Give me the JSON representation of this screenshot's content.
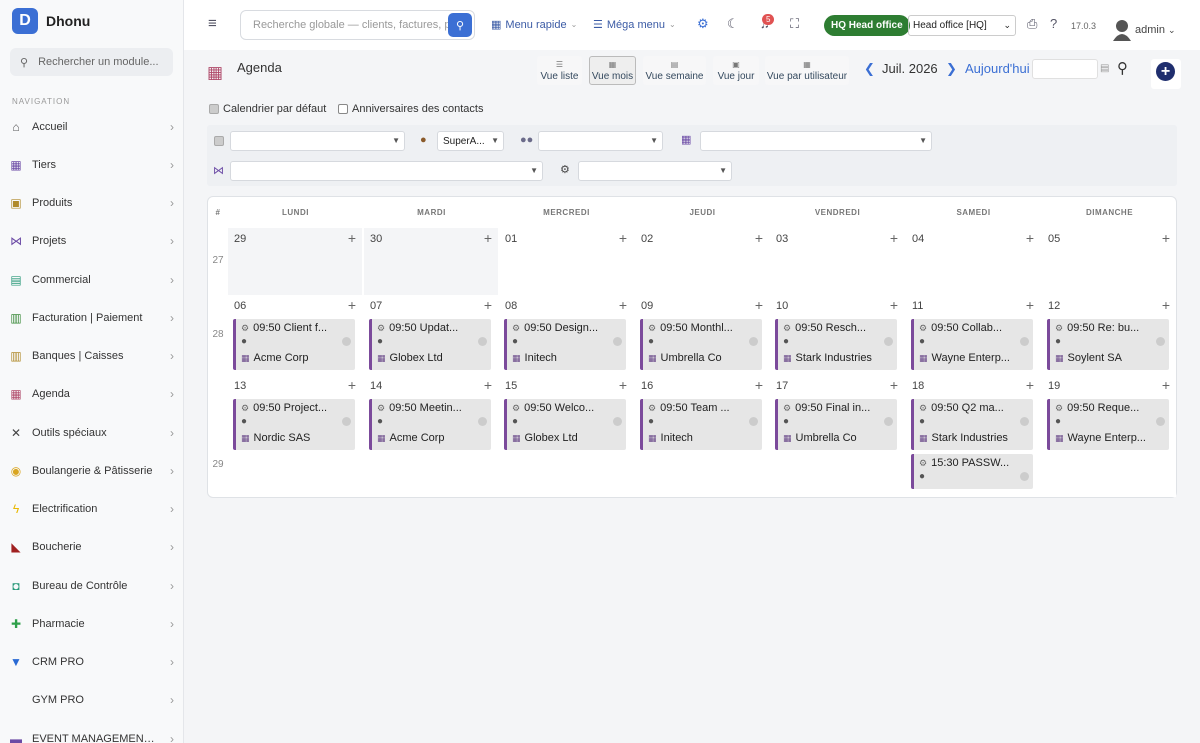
{
  "app": {
    "name": "Dhonu",
    "logo_letter": "D"
  },
  "sidebar": {
    "search_placeholder": "Rechercher un module...",
    "nav_heading": "NAVIGATION",
    "items": [
      {
        "label": "Accueil",
        "icon": "home-icon",
        "glyph": "⌂",
        "color": "#555"
      },
      {
        "label": "Tiers",
        "icon": "building-icon",
        "glyph": "▦",
        "color": "#6b4aa5"
      },
      {
        "label": "Produits",
        "icon": "box-icon",
        "glyph": "▣",
        "color": "#b08a2a"
      },
      {
        "label": "Projets",
        "icon": "sitemap-icon",
        "glyph": "⋈",
        "color": "#6b4aa5"
      },
      {
        "label": "Commercial",
        "icon": "briefcase-icon",
        "glyph": "▤",
        "color": "#2a9a7a"
      },
      {
        "label": "Facturation | Paiement",
        "icon": "invoice-icon",
        "glyph": "▥",
        "color": "#3a8a3a"
      },
      {
        "label": "Banques | Caisses",
        "icon": "bank-icon",
        "glyph": "▥",
        "color": "#b08a2a"
      },
      {
        "label": "Agenda",
        "icon": "calendar-icon",
        "glyph": "▦",
        "color": "#b04a6a"
      },
      {
        "label": "Outils spéciaux",
        "icon": "tools-icon",
        "glyph": "✕",
        "color": "#444"
      },
      {
        "label": "Boulangerie & Pâtisserie",
        "icon": "bread-icon",
        "glyph": "◉",
        "color": "#d9a520"
      },
      {
        "label": "Electrification",
        "icon": "bolt-icon",
        "glyph": "ϟ",
        "color": "#e8b800"
      },
      {
        "label": "Boucherie",
        "icon": "meat-icon",
        "glyph": "◣",
        "color": "#a02020"
      },
      {
        "label": "Bureau de Contrôle",
        "icon": "control-icon",
        "glyph": "◘",
        "color": "#2a9a7a"
      },
      {
        "label": "Pharmacie",
        "icon": "cross-icon",
        "glyph": "✚",
        "color": "#2ea04a"
      },
      {
        "label": "CRM PRO",
        "icon": "filter-icon",
        "glyph": "▼",
        "color": "#2a6ad4"
      },
      {
        "label": "GYM PRO",
        "icon": "gym-icon",
        "glyph": "",
        "color": "#444"
      },
      {
        "label": "EVENT MANAGEMENT P...",
        "icon": "event-icon",
        "glyph": "▬",
        "color": "#6b4aa5"
      }
    ]
  },
  "topbar": {
    "search_placeholder": "Recherche globale — clients, factures, p",
    "menu_rapide": "Menu rapide",
    "mega_menu": "Méga menu",
    "notif_count": "5",
    "hq_badge": "HQ Head office",
    "entity_select": "Head office [HQ]",
    "version": "17.0.3",
    "user": "admin"
  },
  "agenda": {
    "title": "Agenda",
    "views": [
      "Vue liste",
      "Vue mois",
      "Vue semaine",
      "Vue jour",
      "Vue par utilisateur"
    ],
    "active_view": "Vue mois",
    "month": "Juil. 2026",
    "today": "Aujourd'hui",
    "checkbox_default": "Calendrier par défaut",
    "checkbox_birthdays": "Anniversaires des contacts",
    "filter_user": "SuperA...",
    "week_col": "#",
    "day_headers": [
      "LUNDI",
      "MARDI",
      "MERCREDI",
      "JEUDI",
      "VENDREDI",
      "SAMEDI",
      "DIMANCHE"
    ]
  },
  "weeks": [
    {
      "num": "27",
      "days": [
        "29",
        "30",
        "01",
        "02",
        "03",
        "04",
        "05"
      ]
    },
    {
      "num": "28",
      "days": [
        "06",
        "07",
        "08",
        "09",
        "10",
        "11",
        "12"
      ]
    },
    {
      "num": "29",
      "days": [
        "13",
        "14",
        "15",
        "16",
        "17",
        "18",
        "19"
      ]
    }
  ],
  "events": {
    "week28": [
      {
        "title": "09:50 Client f...",
        "company": "Acme Corp"
      },
      {
        "title": "09:50 Updat...",
        "company": "Globex Ltd"
      },
      {
        "title": "09:50 Design...",
        "company": "Initech"
      },
      {
        "title": "09:50 Monthl...",
        "company": "Umbrella Co"
      },
      {
        "title": "09:50 Resch...",
        "company": "Stark Industries"
      },
      {
        "title": "09:50 Collab...",
        "company": "Wayne Enterp..."
      },
      {
        "title": "09:50 Re: bu...",
        "company": "Soylent SA"
      }
    ],
    "week29": [
      {
        "title": "09:50 Project...",
        "company": "Nordic SAS"
      },
      {
        "title": "09:50 Meetin...",
        "company": "Acme Corp"
      },
      {
        "title": "09:50 Welco...",
        "company": "Globex Ltd"
      },
      {
        "title": "09:50 Team ...",
        "company": "Initech"
      },
      {
        "title": "09:50 Final in...",
        "company": "Umbrella Co"
      },
      {
        "title": "09:50 Q2 ma...",
        "company": "Stark Industries"
      },
      {
        "title": "09:50 Reque...",
        "company": "Wayne Enterp..."
      }
    ],
    "extra": {
      "title": "15:30 PASSW..."
    }
  },
  "colors": {
    "accent": "#3b6fd4",
    "hq": "#2e7d32",
    "event_border": "#7b4a9b",
    "agenda_icon": "#b04a6a"
  }
}
